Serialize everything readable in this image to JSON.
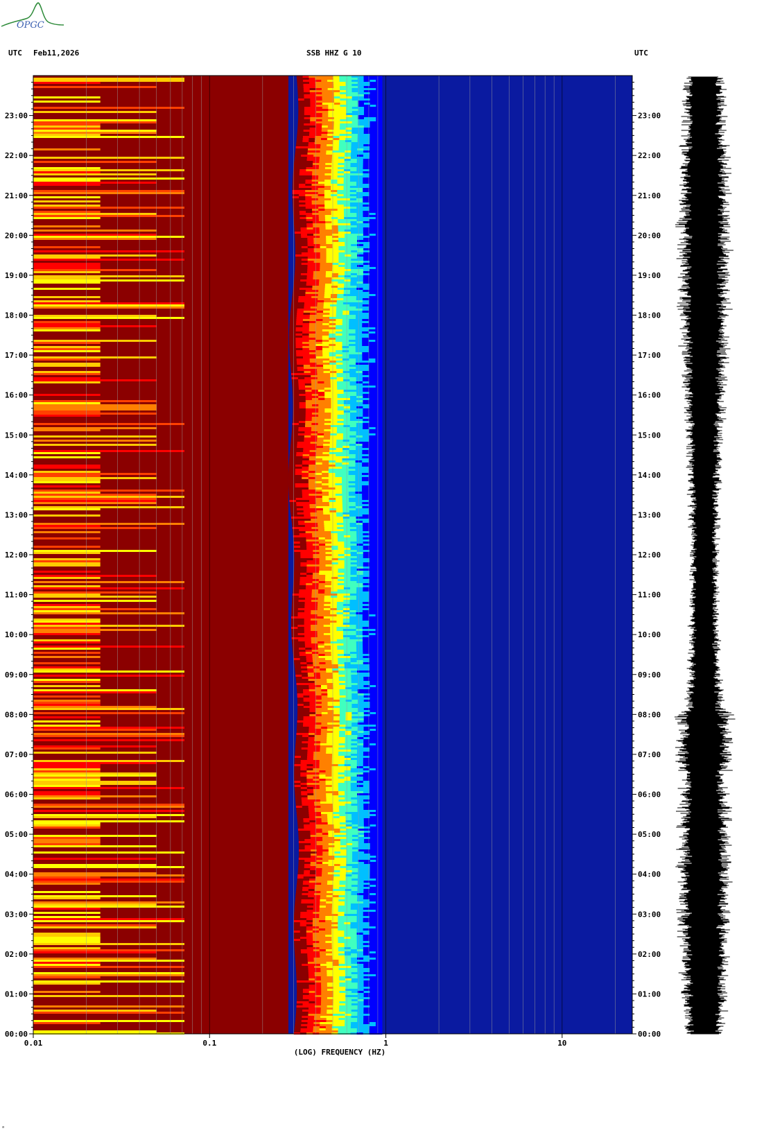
{
  "logo": {
    "text": "OPGC",
    "color": "#2e8b3a",
    "textColor": "#3a5fb0"
  },
  "header": {
    "left_tz": "UTC",
    "date": "Feb11,2026",
    "station": "SSB HHZ G 10",
    "right_tz": "UTC"
  },
  "chart_data": {
    "type": "heatmap",
    "title": "SSB HHZ G 10",
    "xlabel": "(LOG) FREQUENCY (HZ)",
    "x_scale": "log",
    "xlim": [
      0.01,
      25
    ],
    "x_ticks": [
      {
        "value": 0.01,
        "label": "0.01"
      },
      {
        "value": 0.1,
        "label": "0.1"
      },
      {
        "value": 1,
        "label": "1"
      },
      {
        "value": 10,
        "label": "10"
      }
    ],
    "y_ticks": [
      "00:00",
      "01:00",
      "02:00",
      "03:00",
      "04:00",
      "05:00",
      "06:00",
      "07:00",
      "08:00",
      "09:00",
      "10:00",
      "11:00",
      "12:00",
      "13:00",
      "14:00",
      "15:00",
      "16:00",
      "17:00",
      "18:00",
      "19:00",
      "20:00",
      "21:00",
      "22:00",
      "23:00"
    ],
    "ylim_hours": [
      0,
      24
    ],
    "colormap": [
      "#00008b",
      "#0000ff",
      "#00bfff",
      "#40ffbf",
      "#ffff00",
      "#ff8000",
      "#ff0000",
      "#8b0000"
    ],
    "background_color": "#0a1aa0",
    "low_freq_color": "#8b0000",
    "trace_color": "#000000",
    "grid": true
  },
  "footer": {
    "mark": "ᵃ"
  }
}
